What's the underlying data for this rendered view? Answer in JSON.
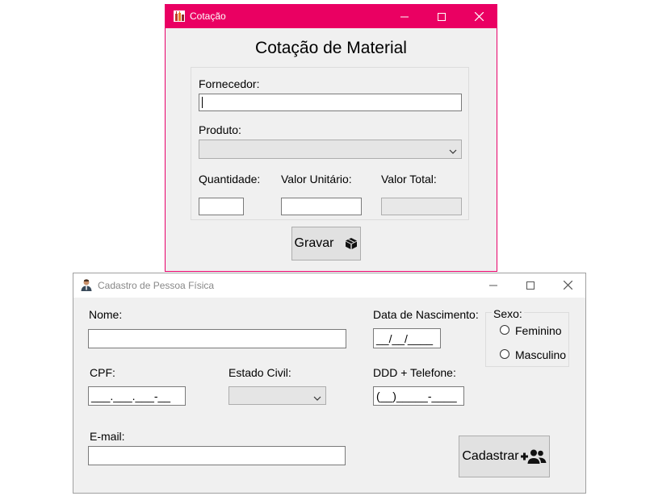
{
  "cotacao": {
    "window_title": "Cotação",
    "heading": "Cotação de Material",
    "fornecedor_label": "Fornecedor:",
    "fornecedor_value": "",
    "produto_label": "Produto:",
    "produto_value": "",
    "quantidade_label": "Quantidade:",
    "valor_unitario_label": "Valor Unitário:",
    "valor_total_label": "Valor Total:",
    "gravar_label": "Gravar",
    "accent_color": "#ea0062"
  },
  "cadastro": {
    "window_title": "Cadastro de Pessoa Física",
    "nome_label": "Nome:",
    "data_nascimento_label": "Data de Nascimento:",
    "data_nascimento_mask": "__/__/____",
    "sexo_label": "Sexo:",
    "feminino_label": "Feminino",
    "masculino_label": "Masculino",
    "cpf_label": "CPF:",
    "cpf_mask": "___.___.___-__",
    "estado_civil_label": "Estado Civil:",
    "ddd_telefone_label": "DDD + Telefone:",
    "telefone_mask": "(__)_____-____",
    "email_label": "E-mail:",
    "cadastrar_label": "Cadastrar"
  },
  "icons": {
    "cotacao_app": "bottles-icon",
    "cadastro_app": "person-icon",
    "gravar": "box-icon",
    "cadastrar": "add-user-icon"
  }
}
